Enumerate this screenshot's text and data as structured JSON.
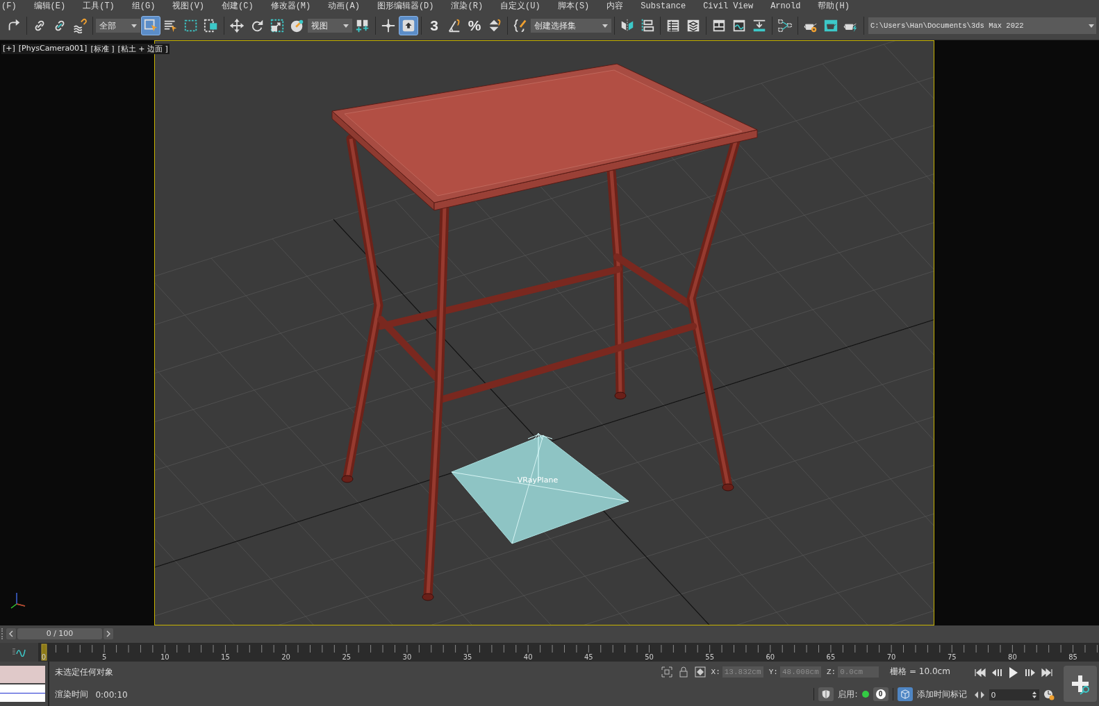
{
  "menu": [
    "(F)",
    "编辑(E)",
    "工具(T)",
    "组(G)",
    "视图(V)",
    "创建(C)",
    "修改器(M)",
    "动画(A)",
    "图形编辑器(D)",
    "渲染(R)",
    "自定义(U)",
    "脚本(S)",
    "内容",
    "Substance",
    "Civil View",
    "Arnold",
    "帮助(H)"
  ],
  "toolbar": [
    [
      {
        "kind": "button",
        "selected": false
      }
    ],
    [
      {
        "kind": "button",
        "selected": false
      },
      {
        "kind": "button",
        "selected": false
      },
      {
        "kind": "button",
        "selected": false
      }
    ],
    [
      {
        "kind": "dropdown",
        "value": "全部"
      },
      {
        "kind": "button",
        "selected": true
      },
      {
        "kind": "button",
        "selected": false
      },
      {
        "kind": "button",
        "selected": false
      },
      {
        "kind": "button",
        "selected": false
      }
    ],
    [
      {
        "kind": "button",
        "selected": false
      },
      {
        "kind": "button",
        "selected": false
      },
      {
        "kind": "button",
        "selected": false
      },
      {
        "kind": "button",
        "selected": false
      },
      {
        "kind": "dropdown",
        "value": "视图"
      },
      {
        "kind": "button",
        "selected": false
      }
    ],
    [
      {
        "kind": "button",
        "selected": false
      },
      {
        "kind": "button",
        "selected": true
      }
    ],
    [
      {
        "kind": "button",
        "selected": false,
        "label": "3"
      },
      {
        "kind": "button",
        "selected": false
      },
      {
        "kind": "button",
        "selected": false,
        "label": "%"
      },
      {
        "kind": "button",
        "selected": false
      }
    ],
    [
      {
        "kind": "button",
        "selected": false
      },
      {
        "kind": "dropdown",
        "value": "创建选择集"
      }
    ],
    [
      {
        "kind": "button",
        "selected": false
      },
      {
        "kind": "button",
        "selected": false
      }
    ],
    [
      {
        "kind": "button",
        "selected": false
      },
      {
        "kind": "button",
        "selected": false
      }
    ],
    [
      {
        "kind": "button",
        "selected": false
      },
      {
        "kind": "button",
        "selected": false
      },
      {
        "kind": "button",
        "selected": false
      }
    ],
    [
      {
        "kind": "button",
        "selected": false
      }
    ],
    [
      {
        "kind": "button",
        "selected": false
      },
      {
        "kind": "button",
        "selected": false
      },
      {
        "kind": "button",
        "selected": false
      }
    ],
    [
      {
        "kind": "path",
        "value": "C:\\Users\\Han\\Documents\\3ds Max 2022"
      }
    ]
  ],
  "viewport": {
    "labels": [
      "[+]",
      "[PhysCamera001]",
      "[标准 ]",
      "[粘土 + 边面 ]"
    ],
    "object_label": "VRayPlane"
  },
  "timeline": {
    "frame_counter": "0 / 100",
    "tick_labels": [
      "0",
      "5",
      "10",
      "15",
      "20",
      "25",
      "30",
      "35",
      "40",
      "45",
      "50",
      "55",
      "60",
      "65",
      "70",
      "75",
      "80",
      "85"
    ]
  },
  "status": {
    "prompt": "未选定任何对象",
    "render_time_label": "渲染时间",
    "render_time": "0:00:10",
    "coords": [
      {
        "axis": "X:",
        "value": "13.832cm",
        "disabled": true
      },
      {
        "axis": "Y:",
        "value": "48.008cm",
        "disabled": true
      },
      {
        "axis": "Z:",
        "value": "0.0cm",
        "disabled": true
      }
    ],
    "grid": "栅格 = 10.0cm",
    "enable_label": "启用:",
    "key_count": "0",
    "add_time_tag": "添加时间标记",
    "current_frame": "0"
  }
}
